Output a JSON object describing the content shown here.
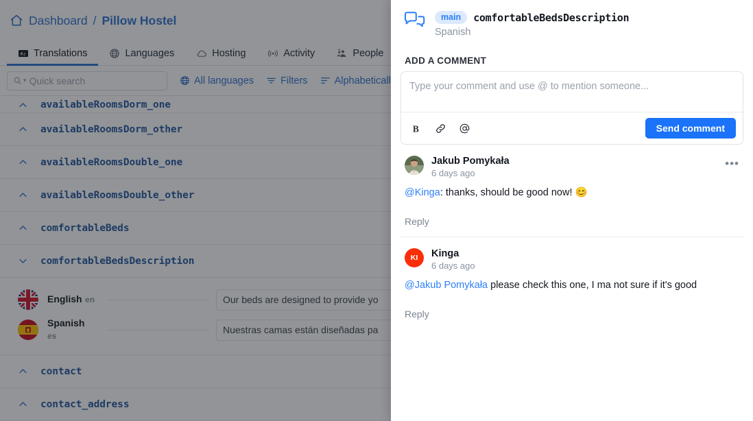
{
  "breadcrumb": {
    "home_icon": "home-icon",
    "root": "Dashboard",
    "separator": "/",
    "current": "Pillow Hostel"
  },
  "tabs": [
    {
      "label": "Translations",
      "icon": "translations-icon",
      "active": true
    },
    {
      "label": "Languages",
      "icon": "globe-icon",
      "active": false
    },
    {
      "label": "Hosting",
      "icon": "cloud-icon",
      "active": false
    },
    {
      "label": "Activity",
      "icon": "activity-icon",
      "active": false
    },
    {
      "label": "People",
      "icon": "people-icon",
      "active": false
    }
  ],
  "filterbar": {
    "search_placeholder": "Quick search",
    "all_languages": "All languages",
    "filters": "Filters",
    "sort": "Alphabetically"
  },
  "key_list": [
    {
      "name": "availableRoomsDorm_one",
      "expanded": false,
      "clipped": true
    },
    {
      "name": "availableRoomsDorm_other",
      "expanded": false
    },
    {
      "name": "availableRoomsDouble_one",
      "expanded": false
    },
    {
      "name": "availableRoomsDouble_other",
      "expanded": false
    },
    {
      "name": "comfortableBeds",
      "expanded": false
    },
    {
      "name": "comfortableBedsDescription",
      "expanded": true
    }
  ],
  "translations": [
    {
      "language": "English",
      "code": "en",
      "flag": "uk-flag",
      "value": "Our beds are designed to provide yo"
    },
    {
      "language": "Spanish",
      "code": "es",
      "flag": "spain-flag",
      "value": "Nuestras camas están diseñadas pa"
    }
  ],
  "key_list_after": [
    {
      "name": "contact",
      "expanded": false
    },
    {
      "name": "contact_address",
      "expanded": false,
      "clipped": true
    }
  ],
  "panel": {
    "icon": "comments-bubble-icon",
    "branch": "main",
    "key": "comfortableBedsDescription",
    "language": "Spanish",
    "section_label": "ADD A COMMENT",
    "composer": {
      "placeholder": "Type your comment and use @ to mention someone...",
      "bold_icon": "bold-icon",
      "link_icon": "link-icon",
      "mention_icon": "mention-at-icon",
      "send_label": "Send comment"
    },
    "comments": [
      {
        "author": "Jakub Pomykała",
        "avatar_type": "photo",
        "time": "6 days ago",
        "mention": "@Kinga",
        "body": ": thanks, should be good now! 😊",
        "reply_label": "Reply",
        "menu_icon": "more-horizontal-icon",
        "has_menu": true,
        "divided": false
      },
      {
        "author": "Kinga",
        "avatar_type": "initials",
        "avatar_initials": "KI",
        "avatar_color": "#fa2f0a",
        "time": "6 days ago",
        "mention": "@Jakub Pomykała",
        "body": " please check this one, I ma not sure if it's good",
        "reply_label": "Reply",
        "has_menu": false,
        "divided": true
      }
    ]
  },
  "colors": {
    "accent_blue": "#2d7ff9",
    "link_blue": "#2f6fd0",
    "key_blue": "#21559e",
    "badge_bg": "#dce9fd",
    "avatar_red": "#fa2f0a"
  }
}
